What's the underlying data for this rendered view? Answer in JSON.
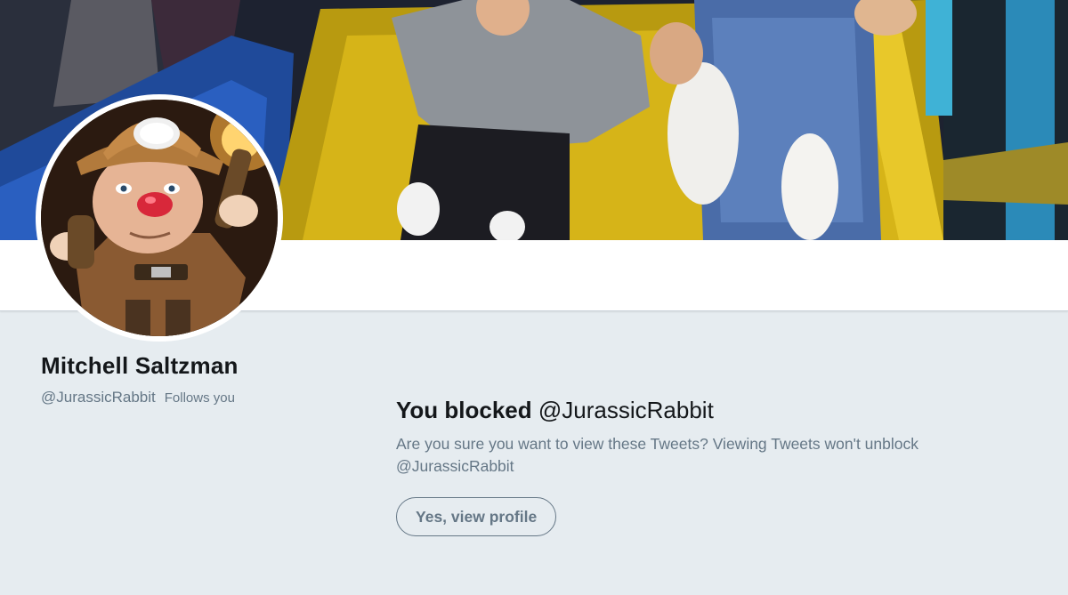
{
  "profile": {
    "name": "Mitchell Saltzman",
    "handle": "@JurassicRabbit",
    "follows_you": "Follows you"
  },
  "blocked_notice": {
    "title_bold": "You blocked",
    "title_handle": "@JurassicRabbit",
    "description": "Are you sure you want to view these Tweets? Viewing Tweets won't unblock @JurassicRabbit",
    "view_button_label": "Yes, view profile"
  },
  "colors": {
    "page_background": "#e6ecf0",
    "secondary_text": "#657786",
    "primary_text": "#14171a"
  }
}
